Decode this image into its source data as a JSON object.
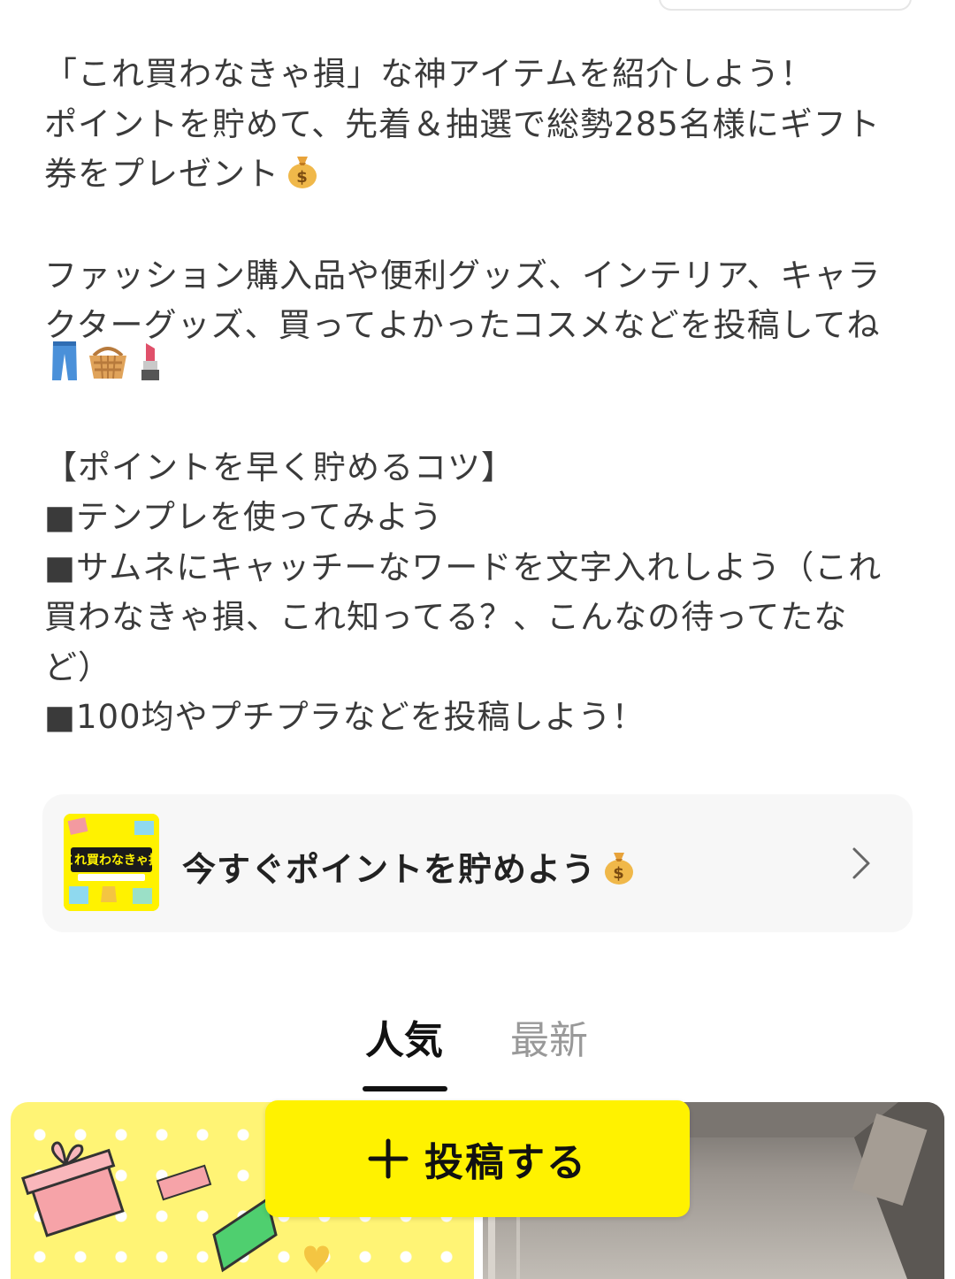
{
  "description": {
    "intro_lines": [
      "「これ買わなきゃ損」な神アイテムを紹介しよう！",
      "ポイントを貯めて、先着＆抽選で総勢285名様にギフト",
      "券をプレゼント"
    ],
    "category_lines": [
      "ファッション購入品や便利グッズ、インテリア、キャラ",
      "クターグッズ、買ってよかったコスメなどを投稿してね"
    ],
    "tips_heading": "【ポイントを早く貯めるコツ】",
    "tips": [
      "■テンプレを使ってみよう",
      "■サムネにキャッチーなワードを文字入れしよう（これ",
      "買わなきゃ損、これ知ってる？、こんなの待ってたな",
      "ど）",
      "■100均やプチプラなどを投稿しよう！"
    ]
  },
  "cta": {
    "label": "今すぐポイントを貯めよう",
    "thumbnail_text": "これ買わなきゃ損"
  },
  "tabs": {
    "popular": "人気",
    "latest": "最新"
  },
  "post_button": {
    "label": "投稿する"
  },
  "colors": {
    "accent_yellow": "#fff200",
    "text": "#3a3a3a",
    "card_bg": "#f7f7f7"
  }
}
